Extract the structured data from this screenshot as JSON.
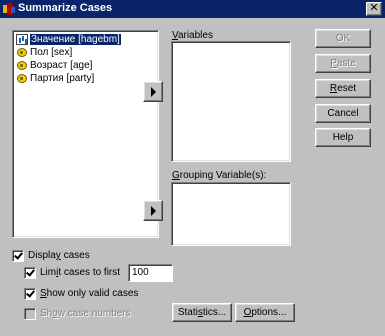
{
  "window": {
    "title": "Summarize Cases",
    "close_glyph": "✕"
  },
  "source_list": {
    "items": [
      {
        "label": "Значение [hagebm]",
        "icon": "scale-icon",
        "selected": true
      },
      {
        "label": "Пол [sex]",
        "icon": "nominal-variable-icon",
        "selected": false
      },
      {
        "label": "Возраст [age]",
        "icon": "nominal-variable-icon",
        "selected": false
      },
      {
        "label": "Партия [party]",
        "icon": "nominal-variable-icon",
        "selected": false
      }
    ]
  },
  "variables": {
    "label_pre": "",
    "label_key": "V",
    "label_post": "ariables"
  },
  "grouping": {
    "label_pre": "",
    "label_key": "G",
    "label_post": "rouping Variable(s):"
  },
  "buttons": {
    "ok": {
      "pre": "",
      "key": "",
      "post": "OK",
      "enabled": false
    },
    "paste": {
      "pre": "",
      "key": "P",
      "post": "aste",
      "enabled": false
    },
    "reset": {
      "pre": "",
      "key": "R",
      "post": "eset",
      "enabled": true
    },
    "cancel": {
      "pre": "",
      "key": "",
      "post": "Cancel",
      "enabled": true
    },
    "help": {
      "pre": "",
      "key": "",
      "post": "Help",
      "enabled": true
    },
    "statistics": {
      "pre": "Stati",
      "key": "s",
      "post": "tics...",
      "enabled": true
    },
    "options": {
      "pre": "",
      "key": "O",
      "post": "ptions...",
      "enabled": true
    }
  },
  "checkboxes": {
    "display_cases": {
      "pre": "Displa",
      "key": "y",
      "post": " cases",
      "checked": true,
      "enabled": true
    },
    "limit_cases": {
      "pre": "Lim",
      "key": "i",
      "post": "t cases to first",
      "checked": true,
      "enabled": true
    },
    "valid_only": {
      "pre": "",
      "key": "S",
      "post": "how only valid cases",
      "checked": true,
      "enabled": true
    },
    "case_numbers": {
      "pre": "Sh",
      "key": "o",
      "post": "w case numbers",
      "checked": false,
      "enabled": false
    }
  },
  "limit_input": {
    "value": "100"
  },
  "colors": {
    "titlebar": "#0a246a",
    "face": "#c0c0c0",
    "selection": "#0a246a"
  }
}
